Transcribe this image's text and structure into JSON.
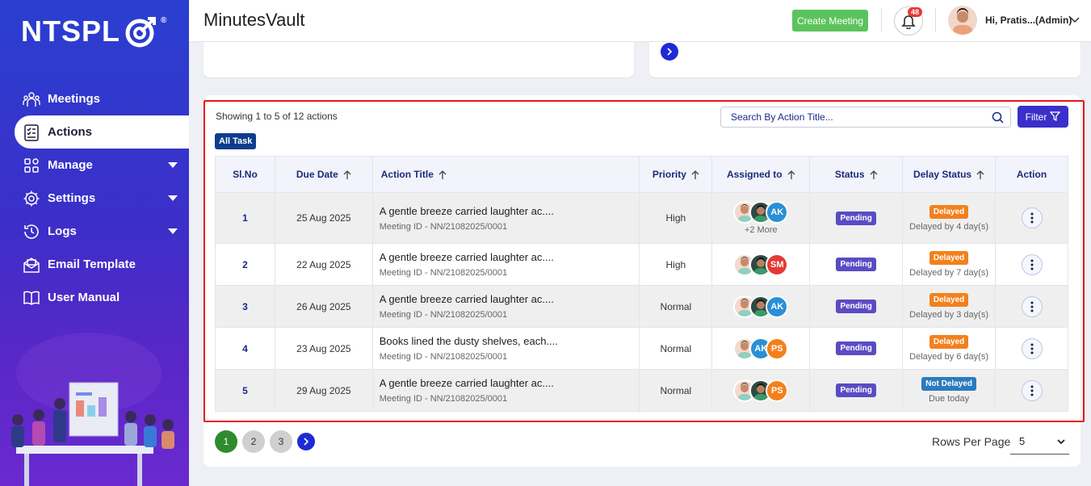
{
  "brand": {
    "logo_text": "NTSPL",
    "reg": "®"
  },
  "sidebar": {
    "items": [
      {
        "label": "Meetings",
        "icon": "meetings-icon"
      },
      {
        "label": "Actions",
        "icon": "checklist-icon",
        "active": true
      },
      {
        "label": "Manage",
        "icon": "grid-icon",
        "expandable": true
      },
      {
        "label": "Settings",
        "icon": "gear-icon",
        "expandable": true
      },
      {
        "label": "Logs",
        "icon": "history-icon",
        "expandable": true
      },
      {
        "label": "Email Template",
        "icon": "mail-icon"
      },
      {
        "label": "User Manual",
        "icon": "book-icon"
      }
    ]
  },
  "header": {
    "title": "MinutesVault",
    "create_label": "Create Meeting",
    "notifications": "48",
    "user": "Hi, Pratis...(Admin)"
  },
  "actions": {
    "showing": "Showing 1 to 5 of 12 actions",
    "all_task": "All Task",
    "search_placeholder": "Search By Action Title...",
    "filter_label": "Filter",
    "columns": [
      "Sl.No",
      "Due Date",
      "Action Title",
      "Priority",
      "Assigned to",
      "Status",
      "Delay Status",
      "Action"
    ],
    "rows": [
      {
        "sl": "1",
        "due": "25 Aug 2025",
        "title": "A gentle breeze carried laughter ac....",
        "meeting": "Meeting ID - NN/21082025/0001",
        "priority": "High",
        "last_av": "AK",
        "last_color": "#2a8fd6",
        "more": "+2 More",
        "status": "Pending",
        "delay": "Delayed",
        "delay_sub": "Delayed by 4 day(s)"
      },
      {
        "sl": "2",
        "due": "22 Aug 2025",
        "title": "A gentle breeze carried laughter ac....",
        "meeting": "Meeting ID - NN/21082025/0001",
        "priority": "High",
        "last_av": "SM",
        "last_color": "#e53935",
        "more": "",
        "status": "Pending",
        "delay": "Delayed",
        "delay_sub": "Delayed by 7 day(s)"
      },
      {
        "sl": "3",
        "due": "26 Aug 2025",
        "title": "A gentle breeze carried laughter ac....",
        "meeting": "Meeting ID - NN/21082025/0001",
        "priority": "Normal",
        "last_av": "AK",
        "last_color": "#2a8fd6",
        "more": "",
        "status": "Pending",
        "delay": "Delayed",
        "delay_sub": "Delayed by 3 day(s)"
      },
      {
        "sl": "4",
        "due": "23 Aug 2025",
        "title": "Books lined the dusty shelves, each....",
        "meeting": "Meeting ID - NN/21082025/0001",
        "priority": "Normal",
        "mid_av": "AK",
        "last_av": "PS",
        "last_color": "#f2811d",
        "more": "",
        "status": "Pending",
        "delay": "Delayed",
        "delay_sub": "Delayed by 6 day(s)"
      },
      {
        "sl": "5",
        "due": "29 Aug 2025",
        "title": "A gentle breeze carried laughter ac....",
        "meeting": "Meeting ID - NN/21082025/0001",
        "priority": "Normal",
        "last_av": "PS",
        "last_color": "#f2811d",
        "more": "",
        "status": "Pending",
        "delay": "Not Delayed",
        "delay_sub": "Due today"
      }
    ]
  },
  "pagination": {
    "pages": [
      "1",
      "2",
      "3"
    ],
    "current": "1",
    "rows_label": "Rows Per Page",
    "rows_value": "5"
  }
}
